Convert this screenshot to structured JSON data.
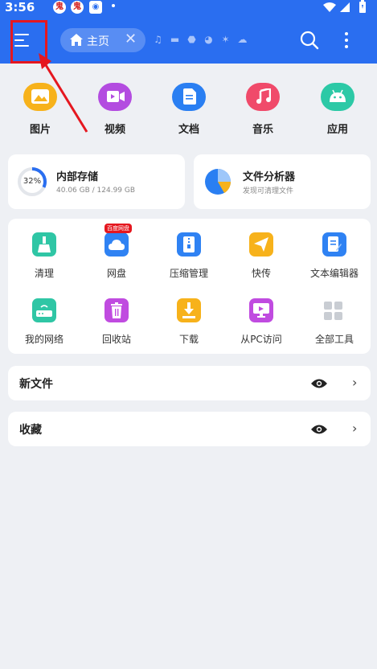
{
  "status_bar": {
    "time": "3:56",
    "app_icon_glyph": "鬼",
    "app_icon_text": "鬼"
  },
  "tabs": {
    "home_label": "主页"
  },
  "icons": {
    "menu": "menu-icon",
    "home": "home-icon",
    "close": "close-icon",
    "search": "search-icon",
    "more": "more-vert-icon"
  },
  "categories": [
    {
      "label": "图片",
      "color": "#f7b21b"
    },
    {
      "label": "视频",
      "color": "#b34ce0"
    },
    {
      "label": "文档",
      "color": "#2a7ff2"
    },
    {
      "label": "音乐",
      "color": "#f04a6a"
    },
    {
      "label": "应用",
      "color": "#2cc9a6"
    }
  ],
  "storage": {
    "title": "内部存储",
    "percent": 32,
    "percent_text": "32%",
    "usage": "40.06 GB / 124.99 GB"
  },
  "analyzer": {
    "title": "文件分析器",
    "subtitle": "发现可清理文件"
  },
  "tools": [
    {
      "label": "清理",
      "color": "#2fc6a5"
    },
    {
      "label": "网盘",
      "color": "#2f82f3",
      "badge": "百度网盘"
    },
    {
      "label": "压缩管理",
      "color": "#2f82f3"
    },
    {
      "label": "快传",
      "color": "#f7b21b"
    },
    {
      "label": "文本编辑器",
      "color": "#2f82f3"
    },
    {
      "label": "我的网络",
      "color": "#2fc6a5"
    },
    {
      "label": "回收站",
      "color": "#c04be0"
    },
    {
      "label": "下载",
      "color": "#f7b21b"
    },
    {
      "label": "从PC访问",
      "color": "#c04be0"
    },
    {
      "label": "全部工具",
      "color": "#c9cdd3"
    }
  ],
  "sections": [
    {
      "title": "新文件"
    },
    {
      "title": "收藏"
    }
  ],
  "colors": {
    "primary": "#2a6ef0",
    "highlight": "#e5171f",
    "background": "#eef0f4"
  }
}
